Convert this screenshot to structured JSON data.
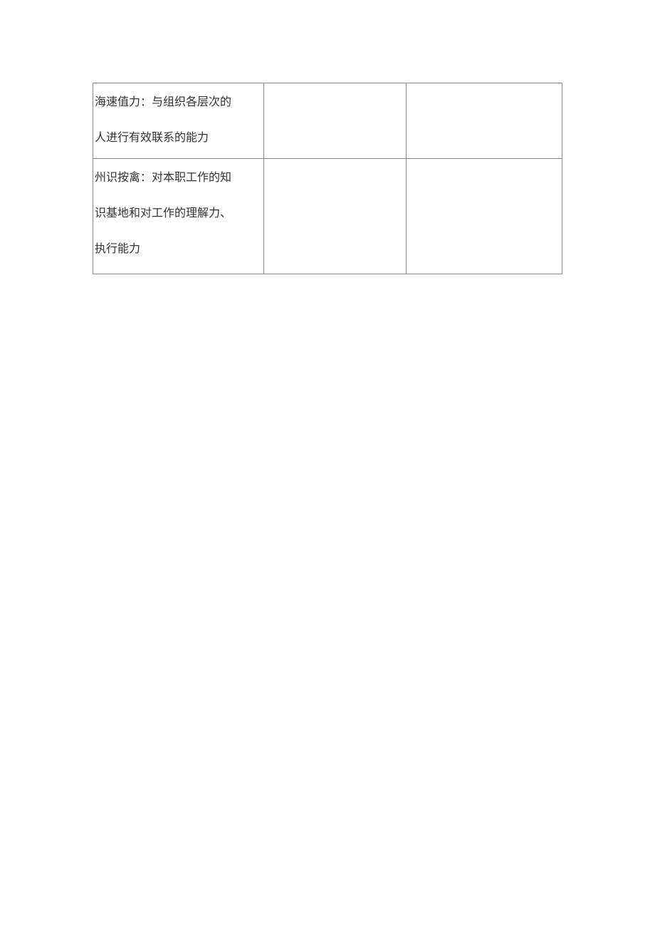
{
  "table": {
    "rows": [
      {
        "col1_lines": [
          "海速值力：与组织各层次的",
          "人进行有效联系的能力"
        ],
        "col2": "",
        "col3": ""
      },
      {
        "col1_lines": [
          "州识按禽：对本职工作的知",
          "识基地和对工作的理解力、",
          "执行能力"
        ],
        "col2": "",
        "col3": ""
      }
    ]
  }
}
